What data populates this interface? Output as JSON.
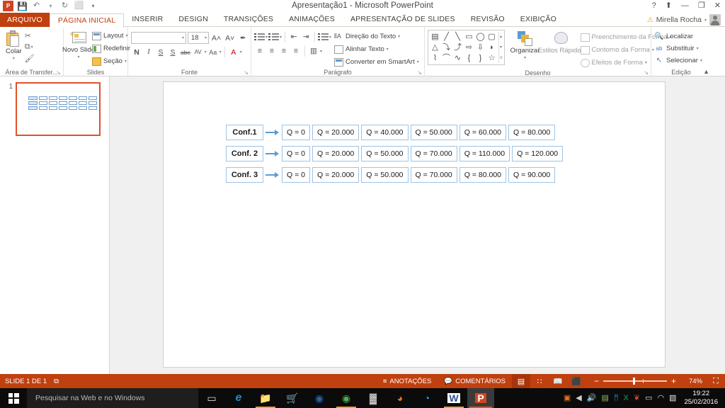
{
  "window": {
    "title": "Apresentação1 - Microsoft PowerPoint",
    "app_logo": "P",
    "quick_access": [
      {
        "name": "powerpoint-logo",
        "glyph": "P"
      },
      {
        "name": "save-icon",
        "glyph": "💾"
      },
      {
        "name": "undo-icon",
        "glyph": "↶"
      },
      {
        "name": "redo-icon",
        "glyph": "↻"
      },
      {
        "name": "start-presentation-icon",
        "glyph": "⬜"
      },
      {
        "name": "customize-qat-icon",
        "glyph": "▾"
      }
    ],
    "controls": [
      {
        "name": "help-button",
        "glyph": "?"
      },
      {
        "name": "ribbon-display-options-button",
        "glyph": "⬆"
      },
      {
        "name": "minimize-button",
        "glyph": "—"
      },
      {
        "name": "restore-button",
        "glyph": "❐"
      },
      {
        "name": "close-button",
        "glyph": "✕"
      }
    ],
    "account": {
      "warning_glyph": "⚠",
      "user": "Mirella Rocha",
      "caret": "▾"
    }
  },
  "ribbon": {
    "tabs": [
      {
        "label": "ARQUIVO",
        "kind": "file"
      },
      {
        "label": "PÁGINA INICIAL",
        "kind": "active"
      },
      {
        "label": "INSERIR",
        "kind": "normal"
      },
      {
        "label": "DESIGN",
        "kind": "normal"
      },
      {
        "label": "TRANSIÇÕES",
        "kind": "normal"
      },
      {
        "label": "ANIMAÇÕES",
        "kind": "normal"
      },
      {
        "label": "APRESENTAÇÃO DE SLIDES",
        "kind": "normal"
      },
      {
        "label": "REVISÃO",
        "kind": "normal"
      },
      {
        "label": "EXIBIÇÃO",
        "kind": "normal"
      }
    ],
    "groups": {
      "clipboard": {
        "label": "Área de Transfer...",
        "paste_label": "Colar",
        "paste_caret": "▾",
        "cut_glyph": "✂",
        "copy_glyph": "⧉",
        "format_painter_glyph": "🖌",
        "dialog_glyph": "↘"
      },
      "slides": {
        "label": "Slides",
        "new_slide_label": "Novo Slide",
        "new_slide_caret": "▾",
        "layout_label": "Layout",
        "reset_label": "Redefinir",
        "section_label": "Seção",
        "caret": "▾"
      },
      "font": {
        "label": "Fonte",
        "font_name_value": "",
        "font_name_placeholder": "",
        "font_size_value": "18",
        "grow_font_glyph": "A˄",
        "shrink_font_glyph": "A˅",
        "clear_format_glyph": "✒",
        "bold_label": "N",
        "italic_label": "I",
        "underline_label": "S",
        "shadow_label": "S",
        "strike_label": "abc",
        "spacing_label": "AV",
        "case_label": "Aa",
        "color_label": "A",
        "caret": "▾",
        "dialog_glyph": "↘"
      },
      "paragraph": {
        "label": "Parágrafo",
        "text_direction_label": "Direção do Texto",
        "align_text_label": "Alinhar Texto",
        "smartart_label": "Converter em SmartArt",
        "caret": "▾",
        "dialog_glyph": "↘"
      },
      "drawing": {
        "label": "Desenho",
        "arrange_label": "Organizar",
        "quick_styles_label": "Estilos Rápidos",
        "shape_fill_label": "Preenchimento da Forma",
        "shape_outline_label": "Contorno da Forma",
        "shape_effects_label": "Efeitos de Forma",
        "caret": "▾",
        "dialog_glyph": "↘",
        "shapes_row1": [
          "▤",
          "╱",
          "╲",
          "▭",
          "◯",
          "▢"
        ],
        "shapes_row2": [
          "△",
          "⤵",
          "⤴",
          "⇨",
          "⇩",
          "◗"
        ],
        "shapes_row3": [
          "⌇",
          "⌒",
          "∿",
          "{",
          "}",
          "☆"
        ],
        "scroll_up": "▴",
        "scroll_down": "▾",
        "scroll_more": "≡"
      },
      "editing": {
        "label": "Edição",
        "find_label": "Localizar",
        "replace_label": "Substituir",
        "select_label": "Selecionar",
        "find_glyph": "🔍",
        "replace_glyph": "ab",
        "select_glyph": "↖",
        "caret": "▾",
        "collapse_glyph": "▲"
      }
    }
  },
  "slide_panel": {
    "slides": [
      {
        "number": "1",
        "selected": true
      }
    ]
  },
  "slide": {
    "diagram": {
      "rows": [
        {
          "label": "Conf.1",
          "cells": [
            "Q = 0",
            "Q = 20.000",
            "Q = 40.000",
            "Q = 50.000",
            "Q = 60.000",
            "Q = 80.000"
          ]
        },
        {
          "label": "Conf. 2",
          "cells": [
            "Q = 0",
            "Q = 20.000",
            "Q = 50.000",
            "Q = 70.000",
            "Q = 110.000",
            "Q = 120.000"
          ]
        },
        {
          "label": "Conf. 3",
          "cells": [
            "Q = 0",
            "Q = 20.000",
            "Q = 50.000",
            "Q = 70.000",
            "Q = 80.000",
            "Q = 90.000"
          ]
        }
      ]
    }
  },
  "status_bar": {
    "slide_count_label": "SLIDE 1 DE 1",
    "language_glyph": "⧉",
    "notes_label": "ANOTAÇÕES",
    "notes_glyph": "≡",
    "comments_label": "COMENTÁRIOS",
    "comments_glyph": "💬",
    "views": [
      {
        "name": "normal-view",
        "glyph": "▤",
        "selected": true
      },
      {
        "name": "slide-sorter-view",
        "glyph": "∷",
        "selected": false
      },
      {
        "name": "reading-view",
        "glyph": "📖",
        "selected": false
      },
      {
        "name": "slideshow-view",
        "glyph": "⬛",
        "selected": false
      }
    ],
    "zoom_out_glyph": "−",
    "zoom_in_glyph": "+",
    "zoom_level": "74%",
    "fit_glyph": "⛶"
  },
  "taskbar": {
    "start_glyph": "⊞",
    "search_placeholder": "Pesquisar na Web e no Windows",
    "task_view_glyph": "▭",
    "apps": [
      {
        "name": "taskbar-edge",
        "glyph": "e",
        "color": "#1b8bd0",
        "state": "idle"
      },
      {
        "name": "taskbar-file-explorer",
        "glyph": "📁",
        "color": "#f0c14b",
        "state": "running"
      },
      {
        "name": "taskbar-store",
        "glyph": "🛒",
        "color": "#ffffff",
        "state": "idle"
      },
      {
        "name": "taskbar-blue-app",
        "glyph": "◉",
        "color": "#2c63a8",
        "state": "idle"
      },
      {
        "name": "taskbar-chrome",
        "glyph": "◉",
        "color": "#4fae4f",
        "state": "running"
      },
      {
        "name": "taskbar-dark-app",
        "glyph": "▓",
        "color": "#dddddd",
        "state": "idle"
      },
      {
        "name": "taskbar-firefox",
        "glyph": "◕",
        "color": "#e8721d",
        "state": "idle"
      },
      {
        "name": "taskbar-teal-app",
        "glyph": "◔",
        "color": "#2aa9d6",
        "state": "idle"
      },
      {
        "name": "taskbar-word",
        "glyph": "W",
        "color": "#2b579a",
        "state": "running"
      },
      {
        "name": "taskbar-powerpoint",
        "glyph": "P",
        "color": "#d04423",
        "state": "active"
      }
    ],
    "tray": [
      {
        "name": "tray-orange-icon",
        "glyph": "▣",
        "color": "#e8721d"
      },
      {
        "name": "tray-show-hidden-icon",
        "glyph": "◀",
        "color": "#d0d0d0"
      },
      {
        "name": "tray-volume-icon",
        "glyph": "🔊",
        "color": "#e8e8e8"
      },
      {
        "name": "tray-antivirus-icon",
        "glyph": "▤",
        "color": "#88c057"
      },
      {
        "name": "tray-bluetooth-icon",
        "glyph": "ᛗ",
        "color": "#3aa0e8"
      },
      {
        "name": "tray-excel-icon",
        "glyph": "X",
        "color": "#1d7044"
      },
      {
        "name": "tray-red-icon",
        "glyph": "❦",
        "color": "#d43f28"
      },
      {
        "name": "tray-battery-icon",
        "glyph": "▭",
        "color": "#e0e0e0"
      },
      {
        "name": "tray-network-icon",
        "glyph": "◠",
        "color": "#d8d8d8"
      },
      {
        "name": "tray-action-center-icon",
        "glyph": "▧",
        "color": "#e0e0e0"
      }
    ],
    "clock_time": "19:22",
    "clock_date": "25/02/2016"
  },
  "colors": {
    "accent": "#c0400f",
    "file_tab": "#c0400f",
    "shape_border": "#9dc3e6",
    "arrow": "#5b9bd5",
    "thumb_selected": "#e0512a"
  }
}
